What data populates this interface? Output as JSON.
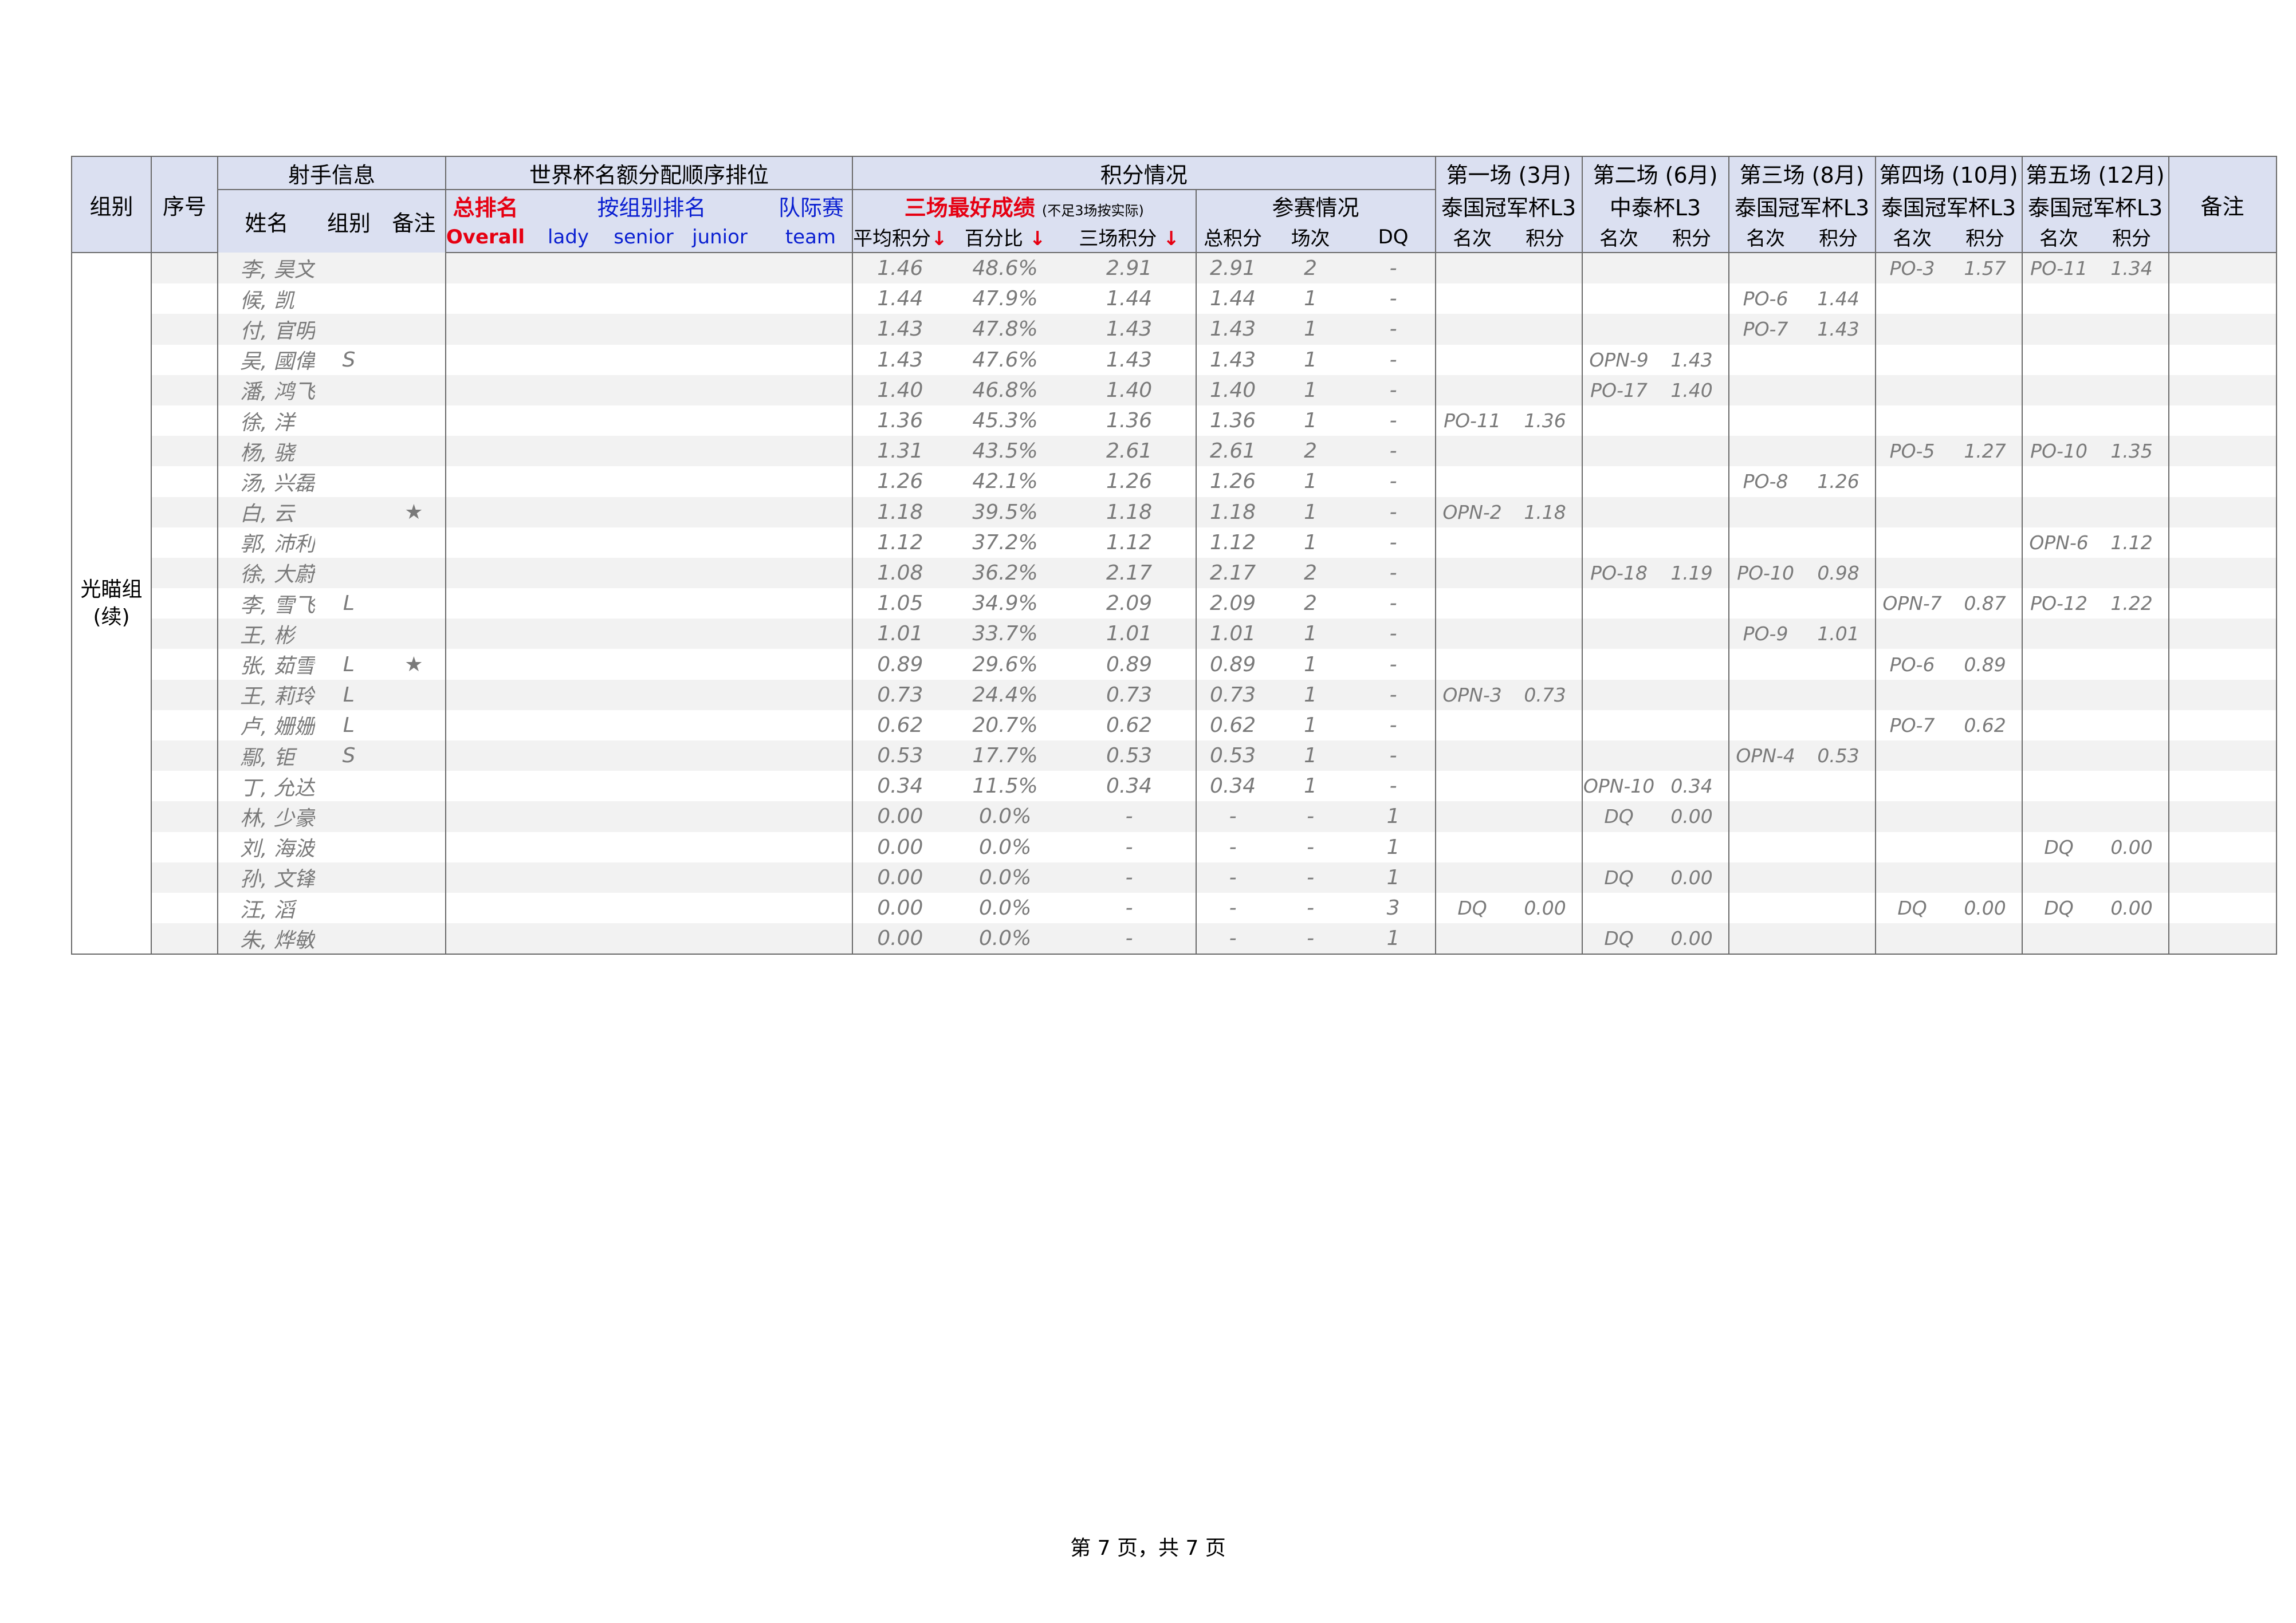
{
  "header": {
    "group": "组别",
    "index": "序号",
    "shooter_info": "射手信息",
    "name": "姓名",
    "group_col": "组别",
    "remark_col": "备注",
    "quota": "世界杯名额分配顺序排位",
    "overall_cn": "总排名",
    "overall_en": "Overall",
    "by_group_cn": "按组别排名",
    "lady": "lady",
    "senior": "senior",
    "junior": "junior",
    "team_cn": "队际赛",
    "team_en": "team",
    "points": "积分情况",
    "best3": "三场最好成绩",
    "best3_note": "(不足3场按实际)",
    "participation": "参赛情况",
    "avg": "平均积分",
    "pct": "百分比",
    "sum3": "三场积分",
    "total": "总积分",
    "count": "场次",
    "dq": "DQ",
    "arrow": "↓",
    "rank": "名次",
    "score": "积分",
    "remark": "备注"
  },
  "events": [
    {
      "round": "第一场 (3月)",
      "name": "泰国冠军杯L3"
    },
    {
      "round": "第二场 (6月)",
      "name": "中泰杯L3"
    },
    {
      "round": "第三场 (8月)",
      "name": "泰国冠军杯L3"
    },
    {
      "round": "第四场 (10月)",
      "name": "泰国冠军杯L3"
    },
    {
      "round": "第五场 (12月)",
      "name": "泰国冠军杯L3"
    }
  ],
  "group_name": "光瞄组\n(续)",
  "rows": [
    {
      "name": "李, 昊文",
      "grp": "",
      "note": "",
      "avg": "1.46",
      "pct": "48.6%",
      "sum3": "2.91",
      "total": "2.91",
      "cnt": "2",
      "dq": "-",
      "e": [
        [
          "",
          ""
        ],
        [
          "",
          ""
        ],
        [
          "",
          ""
        ],
        [
          "PO-3",
          "1.57"
        ],
        [
          "PO-11",
          "1.34"
        ]
      ]
    },
    {
      "name": "候, 凯",
      "grp": "",
      "note": "",
      "avg": "1.44",
      "pct": "47.9%",
      "sum3": "1.44",
      "total": "1.44",
      "cnt": "1",
      "dq": "-",
      "e": [
        [
          "",
          ""
        ],
        [
          "",
          ""
        ],
        [
          "PO-6",
          "1.44"
        ],
        [
          "",
          ""
        ],
        [
          "",
          ""
        ]
      ]
    },
    {
      "name": "付, 官明",
      "grp": "",
      "note": "",
      "avg": "1.43",
      "pct": "47.8%",
      "sum3": "1.43",
      "total": "1.43",
      "cnt": "1",
      "dq": "-",
      "e": [
        [
          "",
          ""
        ],
        [
          "",
          ""
        ],
        [
          "PO-7",
          "1.43"
        ],
        [
          "",
          ""
        ],
        [
          "",
          ""
        ]
      ]
    },
    {
      "name": "吴, 國偉",
      "grp": "S",
      "note": "",
      "avg": "1.43",
      "pct": "47.6%",
      "sum3": "1.43",
      "total": "1.43",
      "cnt": "1",
      "dq": "-",
      "e": [
        [
          "",
          ""
        ],
        [
          "OPN-9",
          "1.43"
        ],
        [
          "",
          ""
        ],
        [
          "",
          ""
        ],
        [
          "",
          ""
        ]
      ]
    },
    {
      "name": "潘, 鸿飞",
      "grp": "",
      "note": "",
      "avg": "1.40",
      "pct": "46.8%",
      "sum3": "1.40",
      "total": "1.40",
      "cnt": "1",
      "dq": "-",
      "e": [
        [
          "",
          ""
        ],
        [
          "PO-17",
          "1.40"
        ],
        [
          "",
          ""
        ],
        [
          "",
          ""
        ],
        [
          "",
          ""
        ]
      ]
    },
    {
      "name": "徐, 洋",
      "grp": "",
      "note": "",
      "avg": "1.36",
      "pct": "45.3%",
      "sum3": "1.36",
      "total": "1.36",
      "cnt": "1",
      "dq": "-",
      "e": [
        [
          "PO-11",
          "1.36"
        ],
        [
          "",
          ""
        ],
        [
          "",
          ""
        ],
        [
          "",
          ""
        ],
        [
          "",
          ""
        ]
      ]
    },
    {
      "name": "杨, 骁",
      "grp": "",
      "note": "",
      "avg": "1.31",
      "pct": "43.5%",
      "sum3": "2.61",
      "total": "2.61",
      "cnt": "2",
      "dq": "-",
      "e": [
        [
          "",
          ""
        ],
        [
          "",
          ""
        ],
        [
          "",
          ""
        ],
        [
          "PO-5",
          "1.27"
        ],
        [
          "PO-10",
          "1.35"
        ]
      ]
    },
    {
      "name": "汤, 兴磊",
      "grp": "",
      "note": "",
      "avg": "1.26",
      "pct": "42.1%",
      "sum3": "1.26",
      "total": "1.26",
      "cnt": "1",
      "dq": "-",
      "e": [
        [
          "",
          ""
        ],
        [
          "",
          ""
        ],
        [
          "PO-8",
          "1.26"
        ],
        [
          "",
          ""
        ],
        [
          "",
          ""
        ]
      ]
    },
    {
      "name": "白, 云",
      "grp": "",
      "note": "★",
      "avg": "1.18",
      "pct": "39.5%",
      "sum3": "1.18",
      "total": "1.18",
      "cnt": "1",
      "dq": "-",
      "e": [
        [
          "OPN-2",
          "1.18"
        ],
        [
          "",
          ""
        ],
        [
          "",
          ""
        ],
        [
          "",
          ""
        ],
        [
          "",
          ""
        ]
      ]
    },
    {
      "name": "郭, 沛利",
      "grp": "",
      "note": "",
      "avg": "1.12",
      "pct": "37.2%",
      "sum3": "1.12",
      "total": "1.12",
      "cnt": "1",
      "dq": "-",
      "e": [
        [
          "",
          ""
        ],
        [
          "",
          ""
        ],
        [
          "",
          ""
        ],
        [
          "",
          ""
        ],
        [
          "OPN-6",
          "1.12"
        ]
      ]
    },
    {
      "name": "徐, 大蔚",
      "grp": "",
      "note": "",
      "avg": "1.08",
      "pct": "36.2%",
      "sum3": "2.17",
      "total": "2.17",
      "cnt": "2",
      "dq": "-",
      "e": [
        [
          "",
          ""
        ],
        [
          "PO-18",
          "1.19"
        ],
        [
          "PO-10",
          "0.98"
        ],
        [
          "",
          ""
        ],
        [
          "",
          ""
        ]
      ]
    },
    {
      "name": "李, 雪飞",
      "grp": "L",
      "note": "",
      "avg": "1.05",
      "pct": "34.9%",
      "sum3": "2.09",
      "total": "2.09",
      "cnt": "2",
      "dq": "-",
      "e": [
        [
          "",
          ""
        ],
        [
          "",
          ""
        ],
        [
          "",
          ""
        ],
        [
          "OPN-7",
          "0.87"
        ],
        [
          "PO-12",
          "1.22"
        ]
      ]
    },
    {
      "name": "王, 彬",
      "grp": "",
      "note": "",
      "avg": "1.01",
      "pct": "33.7%",
      "sum3": "1.01",
      "total": "1.01",
      "cnt": "1",
      "dq": "-",
      "e": [
        [
          "",
          ""
        ],
        [
          "",
          ""
        ],
        [
          "PO-9",
          "1.01"
        ],
        [
          "",
          ""
        ],
        [
          "",
          ""
        ]
      ]
    },
    {
      "name": "张, 茹雪",
      "grp": "L",
      "note": "★",
      "avg": "0.89",
      "pct": "29.6%",
      "sum3": "0.89",
      "total": "0.89",
      "cnt": "1",
      "dq": "-",
      "e": [
        [
          "",
          ""
        ],
        [
          "",
          ""
        ],
        [
          "",
          ""
        ],
        [
          "PO-6",
          "0.89"
        ],
        [
          "",
          ""
        ]
      ]
    },
    {
      "name": "王, 莉玲",
      "grp": "L",
      "note": "",
      "avg": "0.73",
      "pct": "24.4%",
      "sum3": "0.73",
      "total": "0.73",
      "cnt": "1",
      "dq": "-",
      "e": [
        [
          "OPN-3",
          "0.73"
        ],
        [
          "",
          ""
        ],
        [
          "",
          ""
        ],
        [
          "",
          ""
        ],
        [
          "",
          ""
        ]
      ]
    },
    {
      "name": "卢, 姗姗",
      "grp": "L",
      "note": "",
      "avg": "0.62",
      "pct": "20.7%",
      "sum3": "0.62",
      "total": "0.62",
      "cnt": "1",
      "dq": "-",
      "e": [
        [
          "",
          ""
        ],
        [
          "",
          ""
        ],
        [
          "",
          ""
        ],
        [
          "PO-7",
          "0.62"
        ],
        [
          "",
          ""
        ]
      ]
    },
    {
      "name": "鄢, 钜",
      "grp": "S",
      "note": "",
      "avg": "0.53",
      "pct": "17.7%",
      "sum3": "0.53",
      "total": "0.53",
      "cnt": "1",
      "dq": "-",
      "e": [
        [
          "",
          ""
        ],
        [
          "",
          ""
        ],
        [
          "OPN-4",
          "0.53"
        ],
        [
          "",
          ""
        ],
        [
          "",
          ""
        ]
      ]
    },
    {
      "name": "丁, 允达",
      "grp": "",
      "note": "",
      "avg": "0.34",
      "pct": "11.5%",
      "sum3": "0.34",
      "total": "0.34",
      "cnt": "1",
      "dq": "-",
      "e": [
        [
          "",
          ""
        ],
        [
          "OPN-10",
          "0.34"
        ],
        [
          "",
          ""
        ],
        [
          "",
          ""
        ],
        [
          "",
          ""
        ]
      ]
    },
    {
      "name": "林, 少豪",
      "grp": "",
      "note": "",
      "avg": "0.00",
      "pct": "0.0%",
      "sum3": "-",
      "total": "-",
      "cnt": "-",
      "dq": "1",
      "e": [
        [
          "",
          ""
        ],
        [
          "DQ",
          "0.00"
        ],
        [
          "",
          ""
        ],
        [
          "",
          ""
        ],
        [
          "",
          ""
        ]
      ]
    },
    {
      "name": "刘, 海波",
      "grp": "",
      "note": "",
      "avg": "0.00",
      "pct": "0.0%",
      "sum3": "-",
      "total": "-",
      "cnt": "-",
      "dq": "1",
      "e": [
        [
          "",
          ""
        ],
        [
          "",
          ""
        ],
        [
          "",
          ""
        ],
        [
          "",
          ""
        ],
        [
          "DQ",
          "0.00"
        ]
      ]
    },
    {
      "name": "孙, 文锋",
      "grp": "",
      "note": "",
      "avg": "0.00",
      "pct": "0.0%",
      "sum3": "-",
      "total": "-",
      "cnt": "-",
      "dq": "1",
      "e": [
        [
          "",
          ""
        ],
        [
          "DQ",
          "0.00"
        ],
        [
          "",
          ""
        ],
        [
          "",
          ""
        ],
        [
          "",
          ""
        ]
      ]
    },
    {
      "name": "汪, 滔",
      "grp": "",
      "note": "",
      "avg": "0.00",
      "pct": "0.0%",
      "sum3": "-",
      "total": "-",
      "cnt": "-",
      "dq": "3",
      "e": [
        [
          "DQ",
          "0.00"
        ],
        [
          "",
          ""
        ],
        [
          "",
          ""
        ],
        [
          "DQ",
          "0.00"
        ],
        [
          "DQ",
          "0.00"
        ]
      ]
    },
    {
      "name": "朱, 烨敏",
      "grp": "",
      "note": "",
      "avg": "0.00",
      "pct": "0.0%",
      "sum3": "-",
      "total": "-",
      "cnt": "-",
      "dq": "1",
      "e": [
        [
          "",
          ""
        ],
        [
          "DQ",
          "0.00"
        ],
        [
          "",
          ""
        ],
        [
          "",
          ""
        ],
        [
          "",
          ""
        ]
      ]
    }
  ],
  "footer": "第 7 页，共 7 页"
}
